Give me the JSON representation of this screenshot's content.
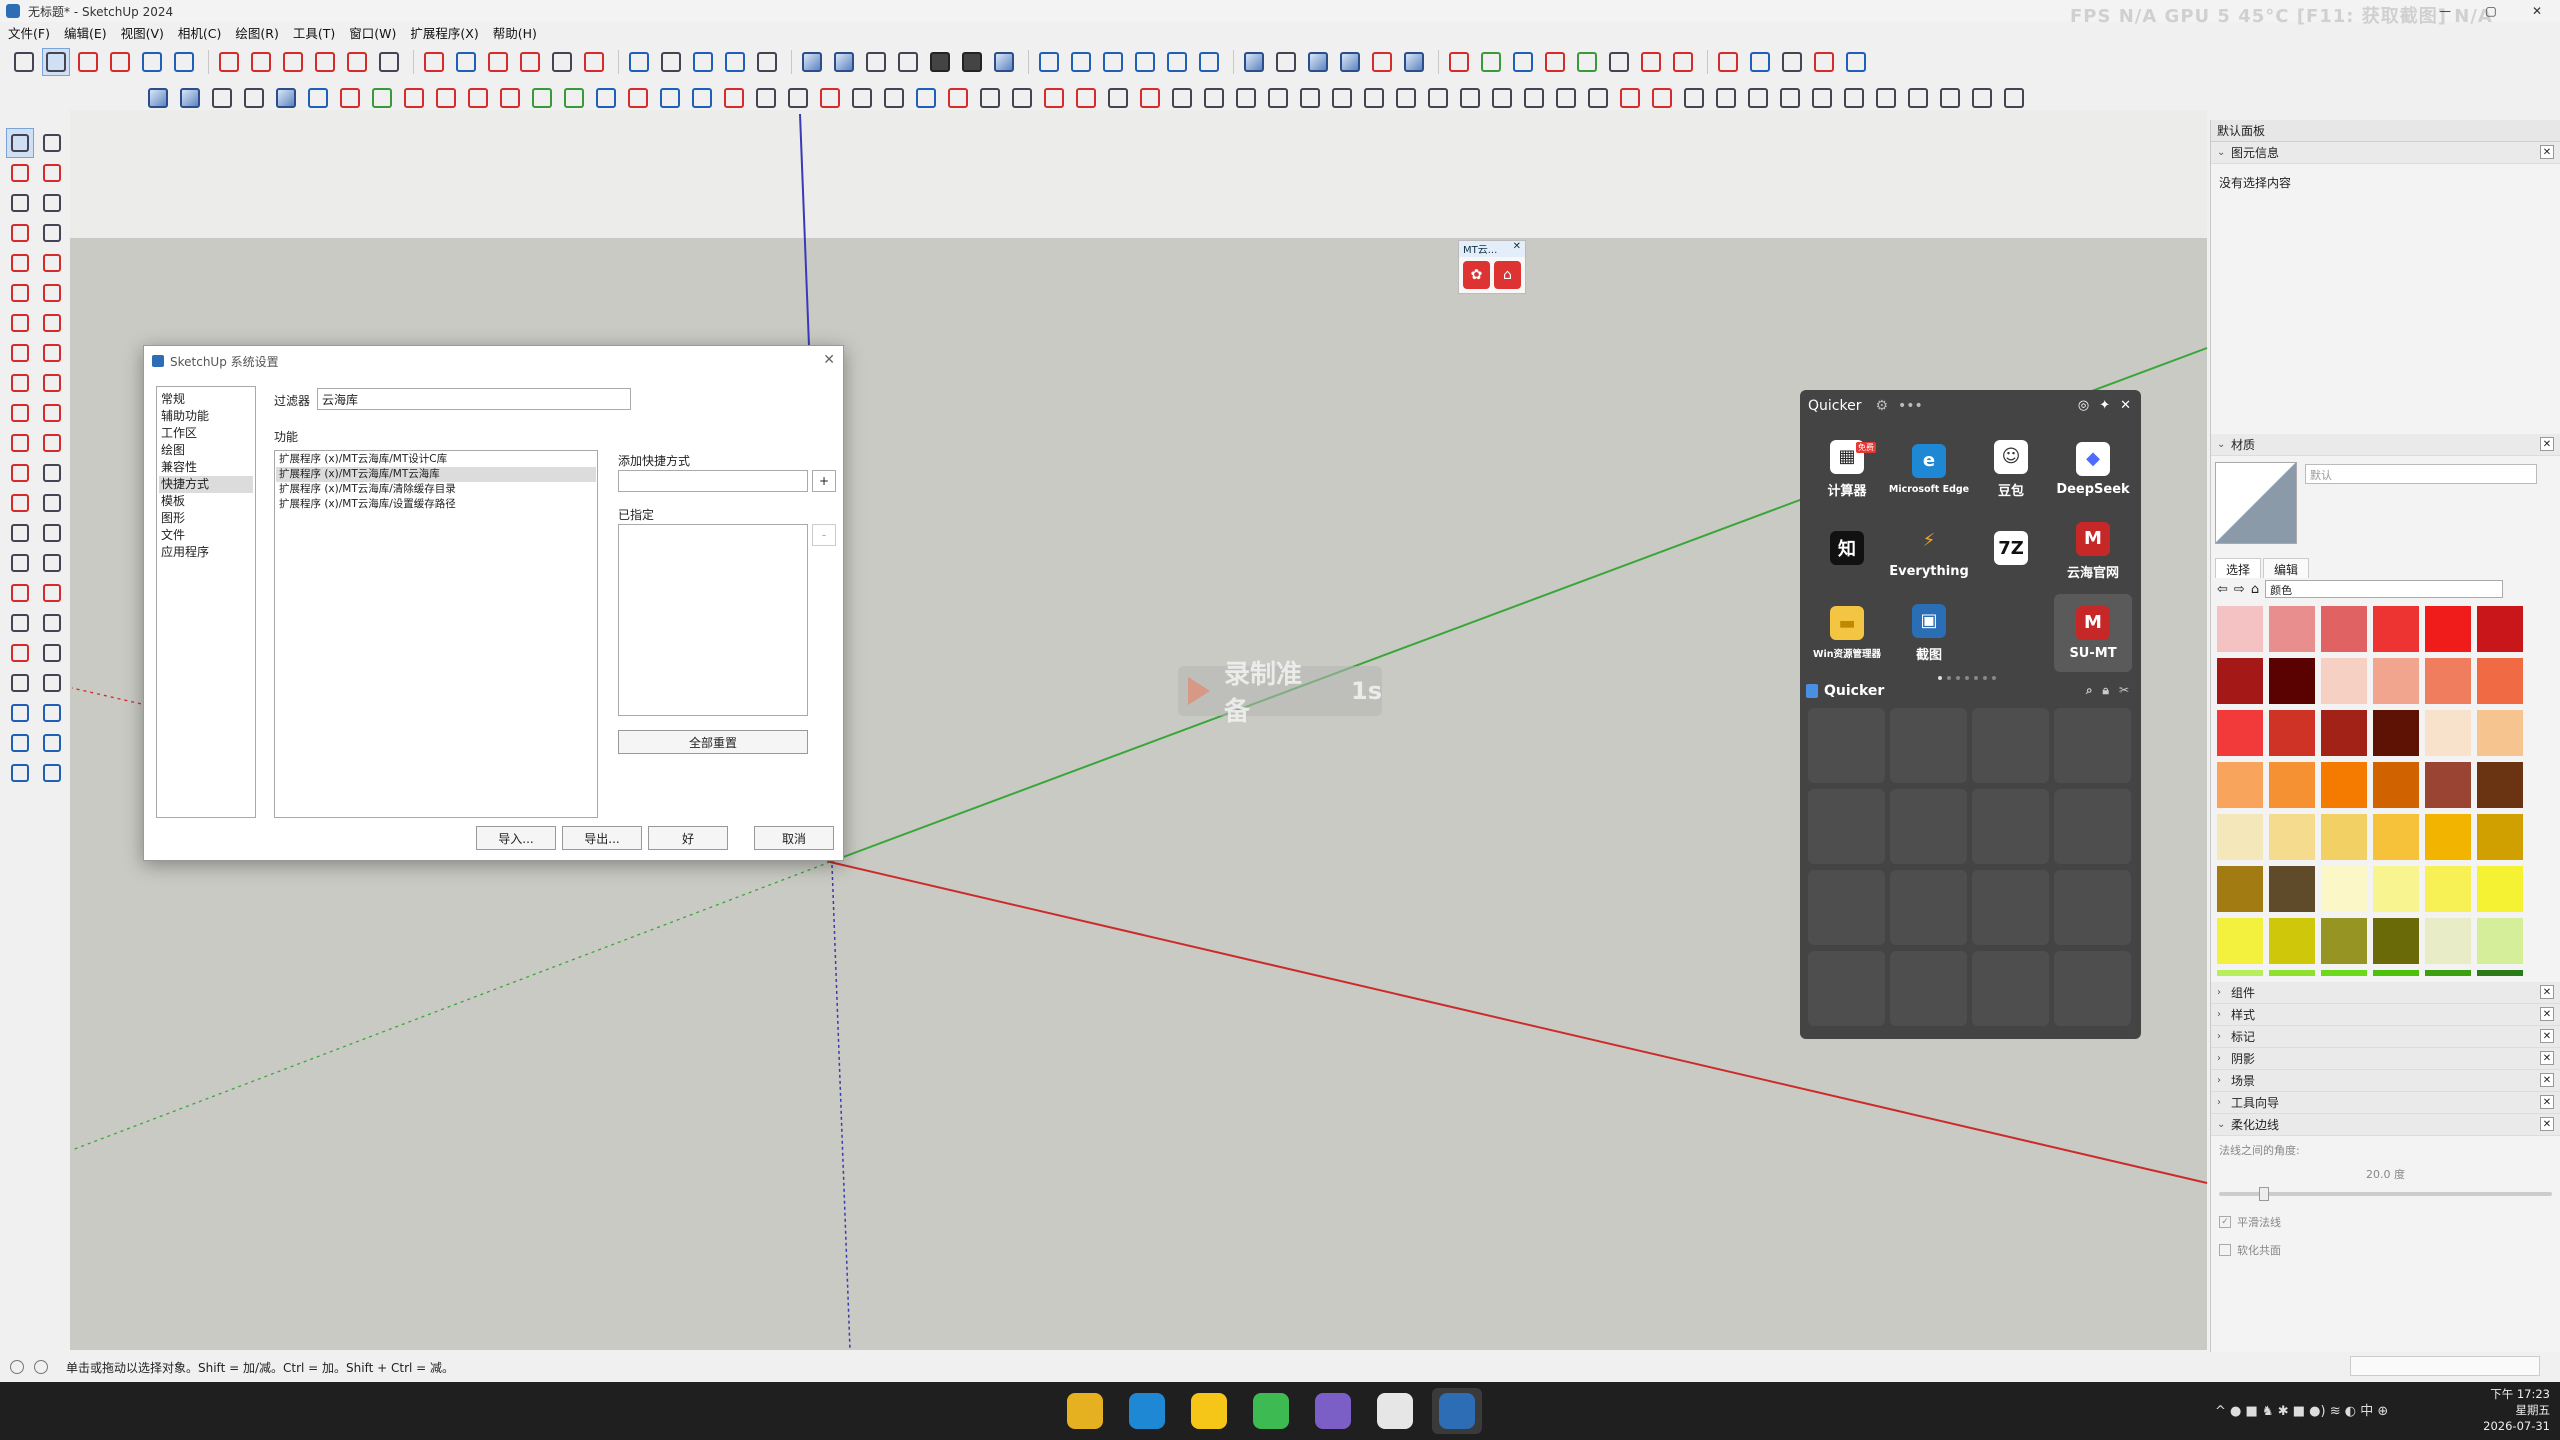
{
  "window": {
    "title": "无标题* - SketchUp 2024",
    "perf_overlay": "FPS N/A   GPU 5  45°C   [F11: 获取截图]  N/A",
    "controls": [
      "—",
      "▢",
      "✕"
    ]
  },
  "menu": [
    "文件(F)",
    "编辑(E)",
    "视图(V)",
    "相机(C)",
    "绘图(R)",
    "工具(T)",
    "窗口(W)",
    "扩展程序(X)",
    "帮助(H)"
  ],
  "mt_mini": {
    "title": "MT云...",
    "close": "✕"
  },
  "recording": {
    "text": "录制准备",
    "seconds": "1s"
  },
  "dialog": {
    "title": "SketchUp 系统设置",
    "close": "✕",
    "nav": [
      "常规",
      "辅助功能",
      "工作区",
      "绘图",
      "兼容性",
      "快捷方式",
      "模板",
      "图形",
      "文件",
      "应用程序"
    ],
    "nav_active": 5,
    "filter_label": "过滤器",
    "filter_value": "云海库",
    "func_label": "功能",
    "functions": [
      "扩展程序 (x)/MT云海库/MT设计C库",
      "扩展程序 (x)/MT云海库/MT云海库",
      "扩展程序 (x)/MT云海库/清除缓存目录",
      "扩展程序 (x)/MT云海库/设置缓存路径"
    ],
    "func_selected": 1,
    "add_label": "添加快捷方式",
    "add_btn": "+",
    "assigned_label": "已指定",
    "remove_btn": "-",
    "reset_btn": "全部重置",
    "import_btn": "导入...",
    "export_btn": "导出...",
    "ok_btn": "好",
    "cancel_btn": "取消"
  },
  "quicker": {
    "title": "Quicker",
    "apps": [
      {
        "label": "计算器",
        "icon": "calculator-icon",
        "glyph": "▦",
        "bg": "#ffffff",
        "fg": "#222",
        "badge": "免费"
      },
      {
        "label": "Microsoft Edge",
        "icon": "edge-icon",
        "glyph": "e",
        "bg": "#1e88d4",
        "fg": "#fff",
        "small": true
      },
      {
        "label": "豆包",
        "icon": "doubao-icon",
        "glyph": "☺",
        "bg": "#ffffff",
        "fg": "#333"
      },
      {
        "label": "DeepSeek",
        "icon": "deepseek-icon",
        "glyph": "◆",
        "bg": "#ffffff",
        "fg": "#4d6bfe"
      },
      {
        "label": "",
        "icon": "zhihu-icon",
        "glyph": "知",
        "bg": "#111111",
        "fg": "#fff"
      },
      {
        "label": "Everything",
        "icon": "everything-icon",
        "glyph": "⚡",
        "bg": "transparent",
        "fg": "#f5a623"
      },
      {
        "label": "",
        "icon": "7zip-icon",
        "glyph": "7Z",
        "bg": "#ffffff",
        "fg": "#111"
      },
      {
        "label": "云海官网",
        "icon": "yunhai-icon",
        "glyph": "M",
        "bg": "#c62828",
        "fg": "#fff"
      },
      {
        "label": "Win资源管理器",
        "icon": "explorer-icon",
        "glyph": "▬",
        "bg": "#f4c542",
        "fg": "#c08a00",
        "small": true
      },
      {
        "label": "截图",
        "icon": "screenshot-icon",
        "glyph": "▣",
        "bg": "#2a6fb5",
        "fg": "#fff"
      },
      {
        "label": "",
        "icon": "empty-slot",
        "glyph": "",
        "bg": "transparent",
        "fg": "#fff"
      },
      {
        "label": "SU-MT",
        "icon": "sumt-icon",
        "glyph": "M",
        "bg": "#c62828",
        "fg": "#fff",
        "highlight": true
      }
    ],
    "bar_title": "Quicker"
  },
  "tray": {
    "title": "默认面板",
    "entity_info": {
      "title": "图元信息",
      "empty": "没有选择内容"
    },
    "materials": {
      "title": "材质",
      "name_placeholder": "默认",
      "tabs": [
        "选择",
        "编辑"
      ],
      "category": "颜色",
      "colors": [
        "#f4c2c2",
        "#e88e8e",
        "#e06262",
        "#ee3333",
        "#f01c1c",
        "#c9161a",
        "#a41818",
        "#5a0202",
        "#f7d0c4",
        "#f2a58e",
        "#f07d5e",
        "#f06a43",
        "#f23a3a",
        "#cf3326",
        "#a32218",
        "#5e1204",
        "#f9e2cc",
        "#f6c48f",
        "#f8a45c",
        "#f59132",
        "#f57b00",
        "#d06200",
        "#9a4533",
        "#6a3412",
        "#f4e7b9",
        "#f5db8e",
        "#f3d064",
        "#f6c23a",
        "#f3b400",
        "#d0a000",
        "#a27c12",
        "#5f4a2a",
        "#fbf7c7",
        "#f8f490",
        "#f8f156",
        "#f5f233",
        "#f4f13e",
        "#cfc70a",
        "#969524",
        "#6a6a08",
        "#e8edc8",
        "#d4ee9a",
        "#b6ee5e",
        "#90e030",
        "#6cd91c",
        "#4dc00a",
        "#3aa010",
        "#2a7a18"
      ]
    },
    "collapsed": [
      "组件",
      "样式",
      "标记",
      "阴影",
      "场景",
      "工具向导"
    ],
    "soften": {
      "title": "柔化边线",
      "angle_label": "法线之间的角度:",
      "angle_value": "20.0  度",
      "smooth_label": "平滑法线",
      "coplanar_label": "软化共面"
    }
  },
  "status": {
    "hint": "单击或拖动以选择对象。Shift = 加/减。Ctrl = 加。Shift + Ctrl = 减。"
  },
  "taskbar": {
    "apps": [
      {
        "icon": "chrome-icon",
        "color": "#e5b120"
      },
      {
        "icon": "edge-icon",
        "color": "#1e88d4"
      },
      {
        "icon": "quicker-icon",
        "color": "#f5c518"
      },
      {
        "icon": "player-icon",
        "color": "#3dba52"
      },
      {
        "icon": "obsidian-icon",
        "color": "#7b5fc7"
      },
      {
        "icon": "unknown-app-icon",
        "color": "#e6e6e6"
      },
      {
        "icon": "sketchup-icon",
        "color": "#2c6db5",
        "active": true
      }
    ],
    "tray_icons": "^  ●  ■  ♞  ✱  ■  ●)  ≋  ◐  中  ⊕",
    "time": "下午 17:23",
    "weekday": "星期五",
    "date": "2026-07-31"
  }
}
